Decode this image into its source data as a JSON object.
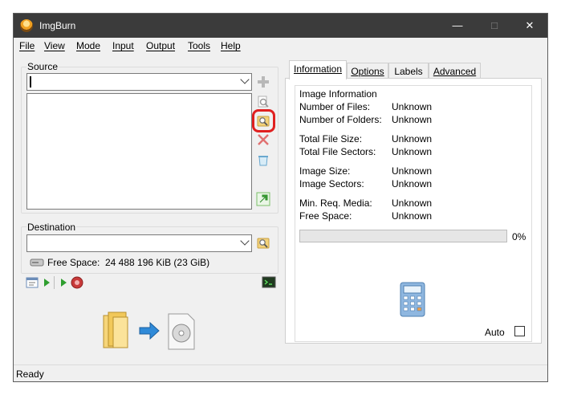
{
  "window": {
    "title": "ImgBurn"
  },
  "menu": [
    "File",
    "View",
    "Mode",
    "Input",
    "Output",
    "Tools",
    "Help"
  ],
  "source": {
    "label": "Source",
    "value": ""
  },
  "destination": {
    "label": "Destination",
    "value": ""
  },
  "free_space": {
    "label": "Free Space:",
    "value": "24 488 196 KiB (23 GiB)"
  },
  "tabs": [
    "Information",
    "Options",
    "Labels",
    "Advanced"
  ],
  "info": {
    "group_title": "Image Information",
    "rows": [
      {
        "label": "Number of Files:",
        "value": "Unknown"
      },
      {
        "label": "Number of Folders:",
        "value": "Unknown"
      },
      {
        "label": "Total File Size:",
        "value": "Unknown"
      },
      {
        "label": "Total File Sectors:",
        "value": "Unknown"
      },
      {
        "label": "Image Size:",
        "value": "Unknown"
      },
      {
        "label": "Image Sectors:",
        "value": "Unknown"
      },
      {
        "label": "Min. Req. Media:",
        "value": "Unknown"
      },
      {
        "label": "Free Space:",
        "value": "Unknown"
      }
    ]
  },
  "progress": {
    "value": 0,
    "text": "0%"
  },
  "auto": {
    "label": "Auto",
    "checked": false
  },
  "status": "Ready",
  "icons": [
    "add-icon",
    "search-file-icon",
    "browse-folder-icon",
    "delete-icon",
    "recycle-icon",
    "build-icon",
    "browse-destination-icon",
    "drive-icon",
    "log-icon",
    "play-icon",
    "play-icon-2",
    "stop-icon",
    "terminal-icon",
    "calculator-icon",
    "folder-icon",
    "arrow-right-icon",
    "disc-image-icon"
  ],
  "accent_highlight": "#e02020"
}
